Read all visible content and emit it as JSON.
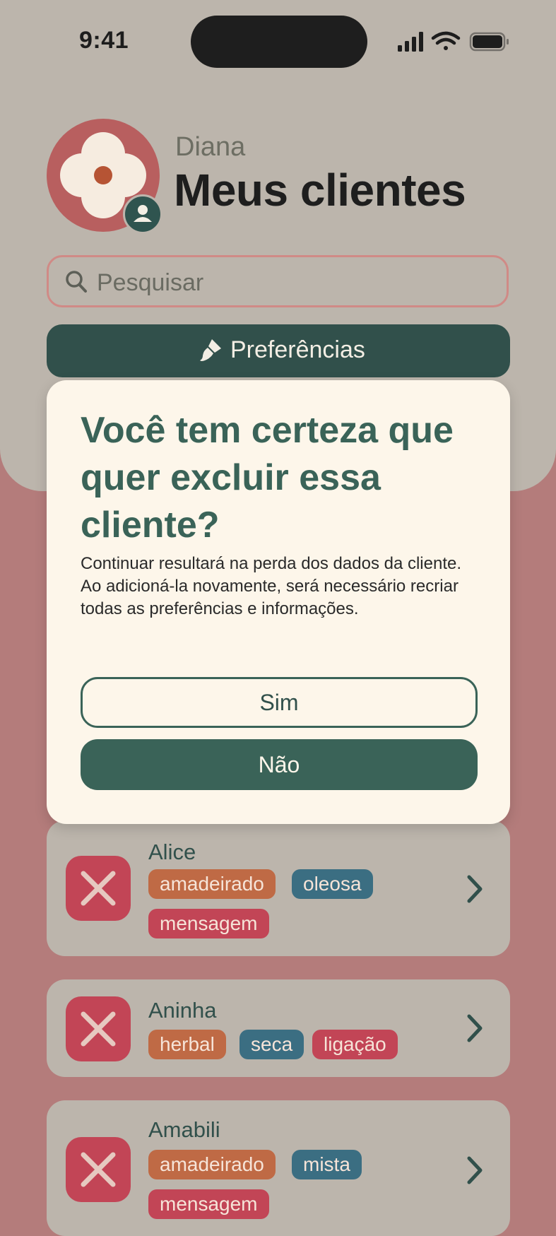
{
  "status_bar": {
    "time": "9:41",
    "icons": [
      "signal-icon",
      "wifi-icon",
      "battery-icon"
    ]
  },
  "header": {
    "user_name": "Diana",
    "title": "Meus clientes"
  },
  "search": {
    "placeholder": "Pesquisar"
  },
  "preferences_button": {
    "label": "Preferências"
  },
  "dialog": {
    "title": "Você tem certeza que quer excluir essa cliente?",
    "body": "Continuar resultará na perda dos dados da cliente. Ao adicioná-la novamente, será necessário recriar todas as preferências e informações.",
    "confirm_label": "Sim",
    "cancel_label": "Não"
  },
  "clients": [
    {
      "name": "Alice",
      "tags": [
        "amadeirado",
        "oleosa",
        "mensagem"
      ]
    },
    {
      "name": "Aninha",
      "tags": [
        "herbal",
        "seca",
        "ligação"
      ]
    },
    {
      "name": "Amabili",
      "tags": [
        "amadeirado",
        "mista",
        "mensagem"
      ]
    }
  ],
  "colors": {
    "background": "#b47c7b",
    "panel": "#bcb5ac",
    "primary": "#31504b",
    "dialog": "#fdf6ea",
    "tag_orange": "#bf6a45",
    "tag_teal": "#3b6e82",
    "tag_pink": "#c24556"
  }
}
